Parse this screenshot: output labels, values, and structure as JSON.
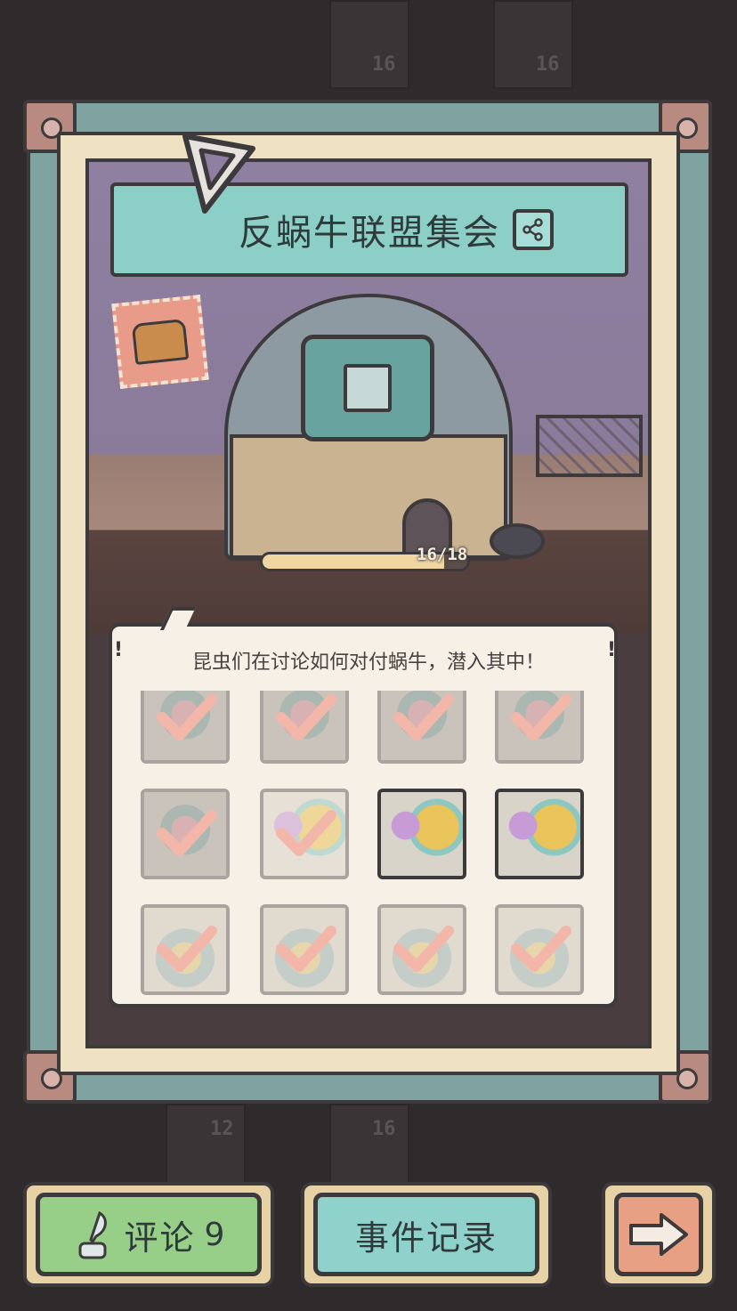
{
  "header": {
    "title": "反蜗牛联盟集会"
  },
  "background": {
    "tile_numbers": [
      "16",
      "16",
      "12",
      "16"
    ]
  },
  "event": {
    "progress_text": "16/18",
    "progress_fraction": 0.889,
    "description": "昆虫们在讨论如何对付蜗牛，潜入其中！",
    "marks": [
      "!",
      "!"
    ]
  },
  "grid": {
    "cells": [
      {
        "checked": true,
        "icon": "beetle-icon"
      },
      {
        "checked": true,
        "icon": "beetle-icon"
      },
      {
        "checked": true,
        "icon": "beetle-icon"
      },
      {
        "checked": true,
        "icon": "beetle-icon"
      },
      {
        "checked": true,
        "icon": "beetle-icon"
      },
      {
        "checked": true,
        "icon": "robot-bug-icon"
      },
      {
        "checked": false,
        "icon": "robot-bug-icon"
      },
      {
        "checked": false,
        "icon": "robot-bug-icon"
      },
      {
        "checked": true,
        "icon": "spider-icon"
      },
      {
        "checked": true,
        "icon": "spider-icon"
      },
      {
        "checked": true,
        "icon": "spider-icon"
      },
      {
        "checked": true,
        "icon": "spider-icon"
      }
    ]
  },
  "buttons": {
    "comment_label": "评论",
    "comment_count": "9",
    "log_label": "事件记录",
    "next_icon": "arrow-right-icon"
  },
  "colors": {
    "check": "#f08a7a",
    "comment_button": "#97cf88",
    "log_button": "#8fd2cb",
    "next_button": "#e8a085",
    "banner": "#8bcfc7"
  }
}
